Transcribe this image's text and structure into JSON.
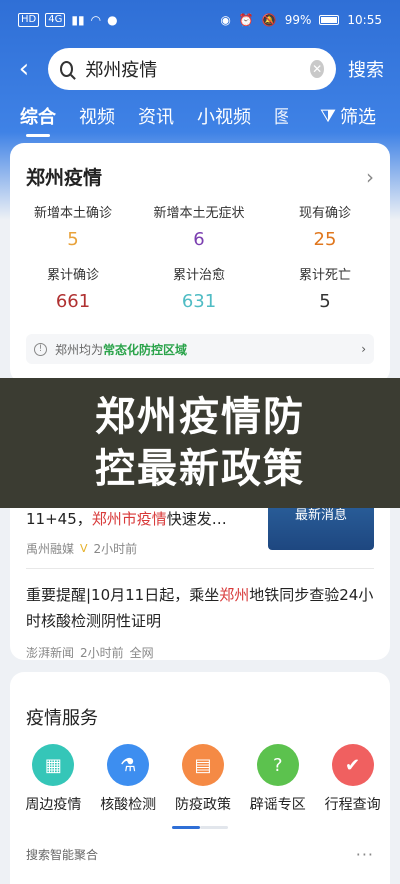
{
  "status_bar": {
    "left_tags": [
      "HD",
      "4G"
    ],
    "battery": "99%",
    "time": "10:55"
  },
  "search": {
    "query": "郑州疫情",
    "button_label": "搜索"
  },
  "tabs": [
    "综合",
    "视频",
    "资讯",
    "小视频",
    "图",
    "筛选"
  ],
  "epidemic_card": {
    "title": "郑州疫情",
    "stats": [
      {
        "label": "新增本土确诊",
        "value": "5",
        "color": "#e8a23a"
      },
      {
        "label": "新增本土无症状",
        "value": "6",
        "color": "#7b3fb0"
      },
      {
        "label": "现有确诊",
        "value": "25",
        "color": "#e0771e"
      },
      {
        "label": "累计确诊",
        "value": "661",
        "color": "#b03131"
      },
      {
        "label": "累计治愈",
        "value": "631",
        "color": "#4fbcc4"
      },
      {
        "label": "累计死亡",
        "value": "5",
        "color": "#333333"
      }
    ],
    "notice_prefix": "郑州均为",
    "notice_green": "常态化防控区域"
  },
  "overlay": {
    "line1": "郑州疫情防",
    "line2": "控最新政策"
  },
  "news": [
    {
      "headline_pre": "11+45，",
      "headline_hl": "郑州市疫情",
      "headline_post": "快速发…",
      "source": "禹州融媒",
      "time": "2小时前",
      "thumb_label": "最新消息"
    },
    {
      "headline_pre": "重要提醒|10月11日起，乘坐",
      "headline_hl": "郑州",
      "headline_post": "地铁同步查验24小时核酸检测阴性证明",
      "source": "澎湃新闻",
      "time": "2小时前",
      "scope": "全网"
    }
  ],
  "services": {
    "title": "疫情服务",
    "items": [
      {
        "label": "周边疫情",
        "color": "#35c6b8",
        "icon": "building-icon"
      },
      {
        "label": "核酸检测",
        "color": "#3d8ef0",
        "icon": "flask-icon"
      },
      {
        "label": "防疫政策",
        "color": "#f58a45",
        "icon": "document-building-icon"
      },
      {
        "label": "辟谣专区",
        "color": "#5cc24e",
        "icon": "chat-question-icon"
      },
      {
        "label": "行程查询",
        "color": "#f06060",
        "icon": "itinerary-check-icon"
      }
    ]
  },
  "footer": {
    "label": "搜索智能聚合",
    "more": "···"
  }
}
